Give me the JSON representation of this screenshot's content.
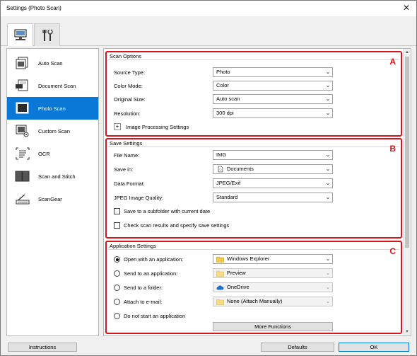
{
  "window": {
    "title": "Settings (Photo Scan)",
    "close_glyph": "✕"
  },
  "tabs": [
    {
      "name": "computer-tab",
      "icon": "computer-icon",
      "active": true
    },
    {
      "name": "tools-tab",
      "icon": "tools-icon",
      "active": false
    }
  ],
  "sidebar": {
    "items": [
      {
        "label": "Auto Scan",
        "icon": "auto-scan-icon"
      },
      {
        "label": "Document Scan",
        "icon": "document-scan-icon"
      },
      {
        "label": "Photo Scan",
        "icon": "photo-scan-icon",
        "active": true
      },
      {
        "label": "Custom Scan",
        "icon": "custom-scan-icon"
      },
      {
        "label": "OCR",
        "icon": "ocr-icon"
      },
      {
        "label": "Scan and Stitch",
        "icon": "scan-and-stitch-icon"
      },
      {
        "label": "ScanGear",
        "icon": "scangear-icon"
      }
    ]
  },
  "scan_options": {
    "title": "Scan Options",
    "letter": "A",
    "source_type_label": "Source Type:",
    "source_type_value": "Photo",
    "color_mode_label": "Color Mode:",
    "color_mode_value": "Color",
    "original_size_label": "Original Size:",
    "original_size_value": "Auto scan",
    "resolution_label": "Resolution:",
    "resolution_value": "300 dpi",
    "image_processing_label": "Image Processing Settings",
    "plus_glyph": "+"
  },
  "save_settings": {
    "title": "Save Settings",
    "letter": "B",
    "file_name_label": "File Name:",
    "file_name_value": "IMG",
    "save_in_label": "Save in:",
    "save_in_value": "Documents",
    "data_format_label": "Data Format:",
    "data_format_value": "JPEG/Exif",
    "jpeg_quality_label": "JPEG Image Quality:",
    "jpeg_quality_value": "Standard",
    "subfolder_label": "Save to a subfolder with current date",
    "check_results_label": "Check scan results and specify save settings"
  },
  "application_settings": {
    "title": "Application Settings",
    "letter": "C",
    "open_app_label": "Open with an application:",
    "open_app_value": "Windows Explorer",
    "send_app_label": "Send to an application:",
    "send_app_value": "Preview",
    "send_folder_label": "Send to a folder:",
    "send_folder_value": "OneDrive",
    "attach_email_label": "Attach to e-mail:",
    "attach_email_value": "None (Attach Manually)",
    "no_app_label": "Do not start an application",
    "more_functions_label": "More Functions"
  },
  "footer": {
    "instructions_label": "Instructions",
    "defaults_label": "Defaults",
    "ok_label": "OK"
  },
  "colors": {
    "accent": "#0a78d7",
    "highlight_border": "#d9141a"
  }
}
